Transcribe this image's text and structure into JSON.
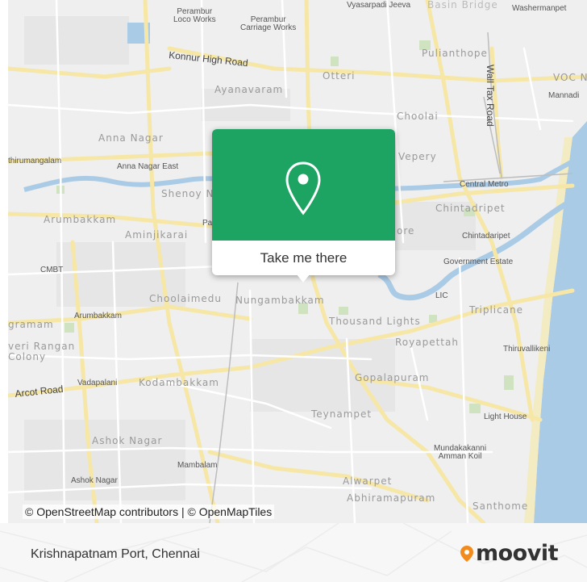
{
  "map": {
    "labels": {
      "perambur_loco": "Perambur\nLoco Works",
      "perambur_carriage": "Perambur\nCarriage Works",
      "vyasarpadi": "Vyasarpadi Jeeva",
      "basin_bridge": "Basin Bridge",
      "washermanpet": "Washermanpet",
      "konnur_road": "Konnur High Road",
      "otteri": "Otteri",
      "pulianthope": "Pulianthope",
      "wall_tax_road": "Wall Tax Road",
      "voc_n": "VOC N",
      "mannadi": "Mannadi",
      "ayanavaram": "Ayanavaram",
      "choolai": "Choolai",
      "anna_nagar": "Anna Nagar",
      "thirumangalam": "thirumangalam",
      "anna_nagar_east": "Anna Nagar East",
      "vepery": "Vepery",
      "central_metro": "Central Metro",
      "shenoy": "Shenoy N",
      "chintadripet_big": "Chintadripet",
      "arumbakkam_big": "Arumbakkam",
      "aminjikarai": "Aminjikarai",
      "pa": "Pa",
      "ore": "ore",
      "chintadaripet": "Chintadaripet",
      "cmbt": "CMBT",
      "government_estate": "Government Estate",
      "choolaimedu": "Choolaimedu",
      "nungambakkam": "Nungambakkam",
      "lic": "LIC",
      "arumbakkam_small": "Arumbakkam",
      "triplicane": "Triplicane",
      "gramam": "gramam",
      "thousand_lights": "Thousand Lights",
      "veri_rangan": "veri Rangan\nColony",
      "royapettah": "Royapettah",
      "thiruvallikeni": "Thiruvallikeni",
      "arcot_road": "Arcot Road",
      "vadapalani": "Vadapalani",
      "kodambakkam": "Kodambakkam",
      "gopalapuram": "Gopalapuram",
      "teynampet": "Teynampet",
      "light_house": "Light House",
      "ashok_nagar_big": "Ashok Nagar",
      "mundakakanni": "Mundakakanni\nAmman Koil",
      "mambalam": "Mambalam",
      "ashok_nagar_small": "Ashok Nagar",
      "alwarpet": "Alwarpet",
      "abhiramapuram": "Abhiramapuram",
      "santhome": "Santhome"
    },
    "popup": {
      "button_label": "Take me there",
      "color": "#1da463",
      "icon": "map-pin-icon"
    },
    "attribution": "© OpenStreetMap contributors | © OpenMapTiles"
  },
  "footer": {
    "destination": "Krishnapatnam Port, Chennai",
    "logo_text": "moovit",
    "logo_color": "#f38b1c"
  }
}
